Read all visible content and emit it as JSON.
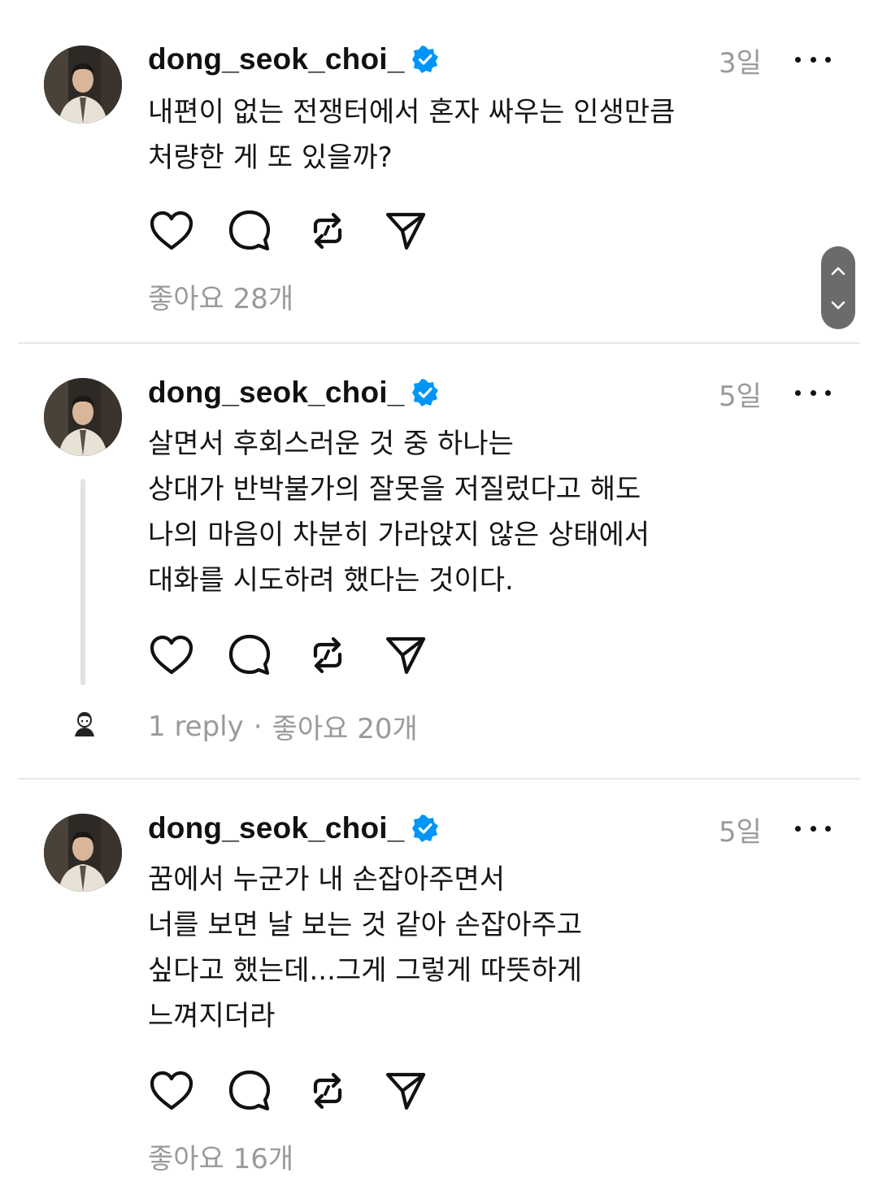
{
  "posts": [
    {
      "username": "dong_seok_choi_",
      "time": "3일",
      "lines": [
        "내편이 없는 전쟁터에서 혼자 싸우는 인생만큼",
        "처량한 게 또 있을까?"
      ],
      "likes_label": "좋아요 28개"
    },
    {
      "username": "dong_seok_choi_",
      "time": "5일",
      "lines": [
        "살면서 후회스러운 것 중 하나는",
        "상대가 반박불가의 잘못을 저질렀다고 해도",
        "나의 마음이 차분히 가라앉지 않은 상태에서",
        "대화를 시도하려 했다는 것이다."
      ],
      "replies_label": "1 reply",
      "separator": "·",
      "likes_label": "좋아요 20개"
    },
    {
      "username": "dong_seok_choi_",
      "time": "5일",
      "lines": [
        "꿈에서 누군가 내 손잡아주면서",
        "너를 보면 날 보는 것 같아 손잡아주고",
        "싶다고 했는데...그게 그렇게 따뜻하게",
        "느껴지더라"
      ],
      "likes_label": "좋아요 16개"
    }
  ],
  "icons": {
    "verified": "verified-badge-icon",
    "more": "more-horizontal-icon",
    "like": "heart-icon",
    "comment": "comment-bubble-icon",
    "repost": "repost-icon",
    "share": "send-icon",
    "scroll_up": "chevron-up-icon",
    "scroll_down": "chevron-down-icon"
  },
  "colors": {
    "verified_blue": "#0095F6",
    "muted_text": "#9a9a9a",
    "divider": "#e6e6e6"
  }
}
